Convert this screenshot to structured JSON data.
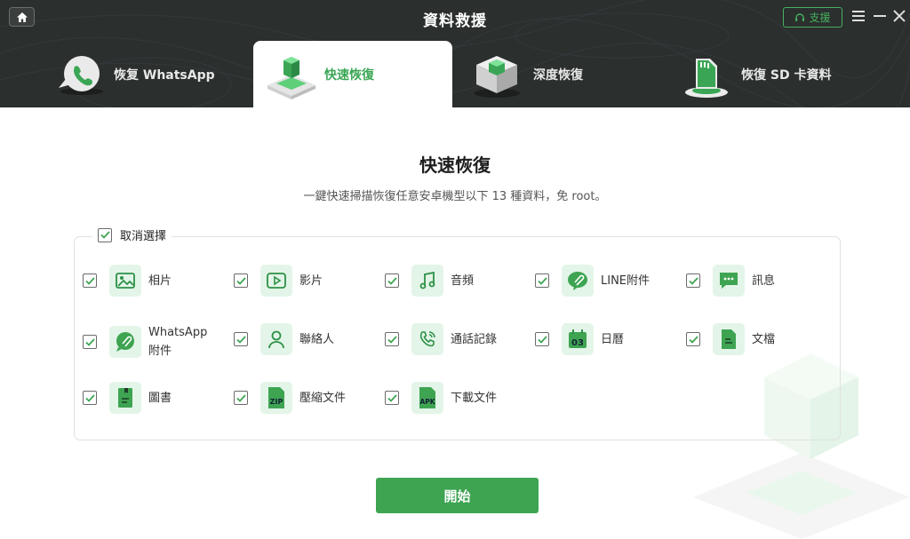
{
  "app": {
    "title": "資料救援",
    "support_label": "支援"
  },
  "tabs": [
    {
      "label": "恢复 WhatsApp"
    },
    {
      "label": "快速恢復"
    },
    {
      "label": "深度恢復"
    },
    {
      "label": "恢復 SD 卡資料"
    }
  ],
  "main": {
    "title": "快速恢復",
    "subtitle": "一鍵快速掃描恢復任意安卓機型以下 13 種資料，免 root。",
    "deselect_label": "取消選擇",
    "start_label": "開始"
  },
  "items": [
    {
      "label": "相片",
      "checked": true,
      "icon": "photo-icon"
    },
    {
      "label": "影片",
      "checked": true,
      "icon": "video-icon"
    },
    {
      "label": "音頻",
      "checked": true,
      "icon": "music-icon"
    },
    {
      "label": "LINE附件",
      "checked": true,
      "icon": "line-attachment-icon"
    },
    {
      "label": "訊息",
      "checked": true,
      "icon": "message-icon"
    },
    {
      "label": "WhatsApp附件",
      "checked": true,
      "icon": "whatsapp-attachment-icon"
    },
    {
      "label": "聯絡人",
      "checked": true,
      "icon": "contact-icon"
    },
    {
      "label": "通話記錄",
      "checked": true,
      "icon": "call-log-icon"
    },
    {
      "label": "日曆",
      "checked": true,
      "icon": "calendar-icon"
    },
    {
      "label": "文檔",
      "checked": true,
      "icon": "document-icon"
    },
    {
      "label": "圖書",
      "checked": true,
      "icon": "book-icon"
    },
    {
      "label": "壓縮文件",
      "checked": true,
      "icon": "zip-icon"
    },
    {
      "label": "下載文件",
      "checked": true,
      "icon": "apk-icon"
    }
  ],
  "icon_texts": {
    "calendar_day": "03",
    "zip": "ZIP",
    "apk": "APK"
  },
  "colors": {
    "accent": "#3ea452",
    "header_bg": "#2b2f2e",
    "icon_bg": "#e3f5e8"
  }
}
